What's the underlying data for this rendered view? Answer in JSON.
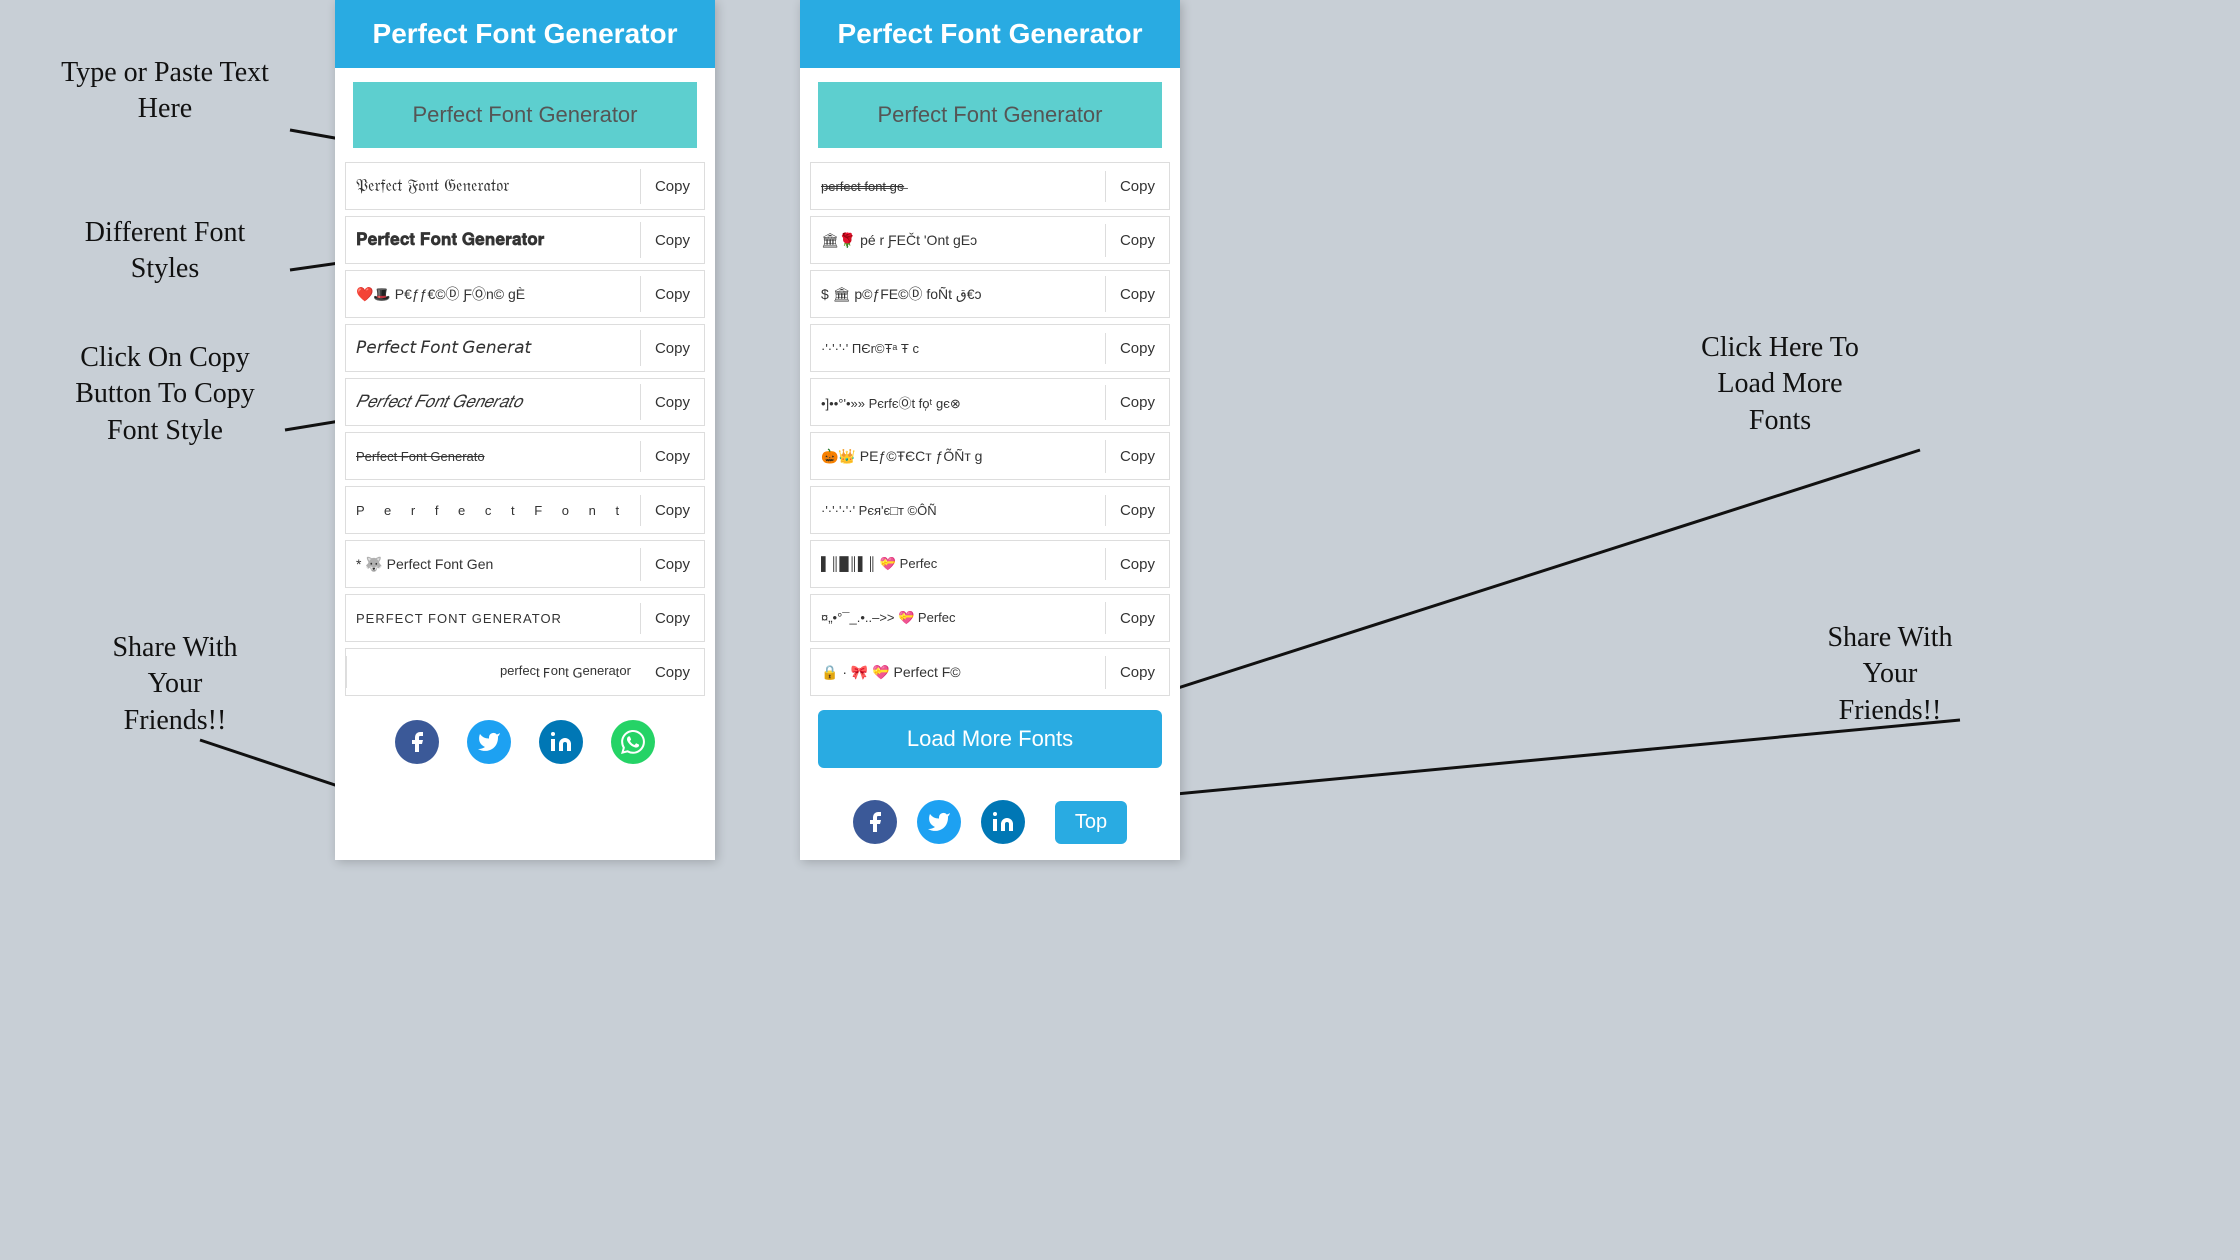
{
  "app": {
    "title": "Perfect Font Generator",
    "background_color": "#c8cfd6"
  },
  "annotations": {
    "type_paste": "Type or Paste Text\nHere",
    "different_fonts": "Different Font\nStyles",
    "click_copy": "Click On Copy\nButton To Copy\nFont Style",
    "share": "Share With\nYour\nFriends!!",
    "click_load": "Click Here To\nLoad More\nFonts",
    "share_right": "Share With\nYour\nFriends!!"
  },
  "left_panel": {
    "header": "Perfect Font Generator",
    "input_placeholder": "Perfect Font Generator",
    "font_rows": [
      {
        "text": "𝔓𝔢𝔯𝔣𝔢𝔠𝔱 𝔉𝔬𝔫𝔱 𝔊𝔢𝔫𝔢𝔯𝔞𝔱𝔬𝔯",
        "style": "fraktur",
        "copy_label": "Copy"
      },
      {
        "text": "𝐏𝐞𝐫𝐟𝐞𝐜𝐭 𝐅𝐨𝐧𝐭 𝐆𝐞𝐧𝐞𝐫𝐚𝐭𝐨𝐫",
        "style": "bold",
        "copy_label": "Copy"
      },
      {
        "text": "❤️🎩 P€ƒƒ€©Ⓓ ƑⓄn© gÈ",
        "style": "emoji",
        "copy_label": "Copy"
      },
      {
        "text": "𝘗𝘦𝘳𝘧𝘦𝘤𝘵 𝘍𝘰𝘯𝘵 𝘎𝘦𝘯𝘦𝘳𝘢𝘵",
        "style": "italic",
        "copy_label": "Copy"
      },
      {
        "text": "𝑃𝑒𝑟𝑓𝑒𝑐𝑡 𝐹𝑜𝑛𝑡 𝐺𝑒𝑛𝑒𝑟𝑎𝑡𝑜",
        "style": "math-italic",
        "copy_label": "Copy"
      },
      {
        "text": "Perfect Font Generator",
        "style": "strikethrough",
        "copy_label": "Copy"
      },
      {
        "text": "P e r f e c t  F o n t",
        "style": "spaced",
        "copy_label": "Copy"
      },
      {
        "text": "* 🐺 Perfect Font Gen",
        "style": "emoji2",
        "copy_label": "Copy"
      },
      {
        "text": "PERFECT FONT GENERATOR",
        "style": "caps",
        "copy_label": "Copy"
      },
      {
        "text": "ɹoʇɐɹǝuǝ⅁ ʇuoℲ ʇɔǝɟɹǝd",
        "style": "flip",
        "copy_label": "Copy"
      }
    ],
    "social": [
      "facebook",
      "twitter",
      "linkedin",
      "whatsapp"
    ]
  },
  "right_panel": {
    "header": "Perfect Font Generator",
    "input_placeholder": "Perfect Font Generator",
    "font_rows": [
      {
        "text": "p̸e̸r̸f̸e̸c̸t̸ f̸o̸n̸t̸ ge̸",
        "style": "strikethrough2",
        "copy_label": "Copy"
      },
      {
        "text": "🏛🌹 pé r ƑEČt 'Ont gEↄ",
        "style": "emoji3",
        "copy_label": "Copy"
      },
      {
        "text": "$ 🏛 p©ƒFE©Ⓓ foÑt ق€ɔ",
        "style": "emoji4",
        "copy_label": "Copy"
      },
      {
        "text": "·'·'·'·' ΠЄr©Ŧᵃ Ŧ c",
        "style": "dots",
        "copy_label": "Copy"
      },
      {
        "text": "•]••°'•»» PєrfєⓄt fo᷊ᵗ gє⊗",
        "style": "bullets",
        "copy_label": "Copy"
      },
      {
        "text": "🎃👑 ΡEƒ©ŦЄCᴛ ƒÕÑᴛ g",
        "style": "emoji5",
        "copy_label": "Copy"
      },
      {
        "text": "·'·'·'·'·' Pєя'є□т ©ÔÑ",
        "style": "dots2",
        "copy_label": "Copy"
      },
      {
        "text": "▌║█║▌║ 💝 Perfec",
        "style": "barcode",
        "copy_label": "Copy"
      },
      {
        "text": "¤„•°¯_.•..–>> 💝 Perfec",
        "style": "deco",
        "copy_label": "Copy"
      },
      {
        "text": "🔒 · 🎀 💝 Perfect F©",
        "style": "emoji6",
        "copy_label": "Copy"
      }
    ],
    "load_more_label": "Load More Fonts",
    "top_label": "Top",
    "social": [
      "facebook",
      "twitter",
      "linkedin"
    ]
  },
  "icons": {
    "facebook": "f",
    "twitter": "t",
    "linkedin": "in",
    "whatsapp": "w"
  }
}
